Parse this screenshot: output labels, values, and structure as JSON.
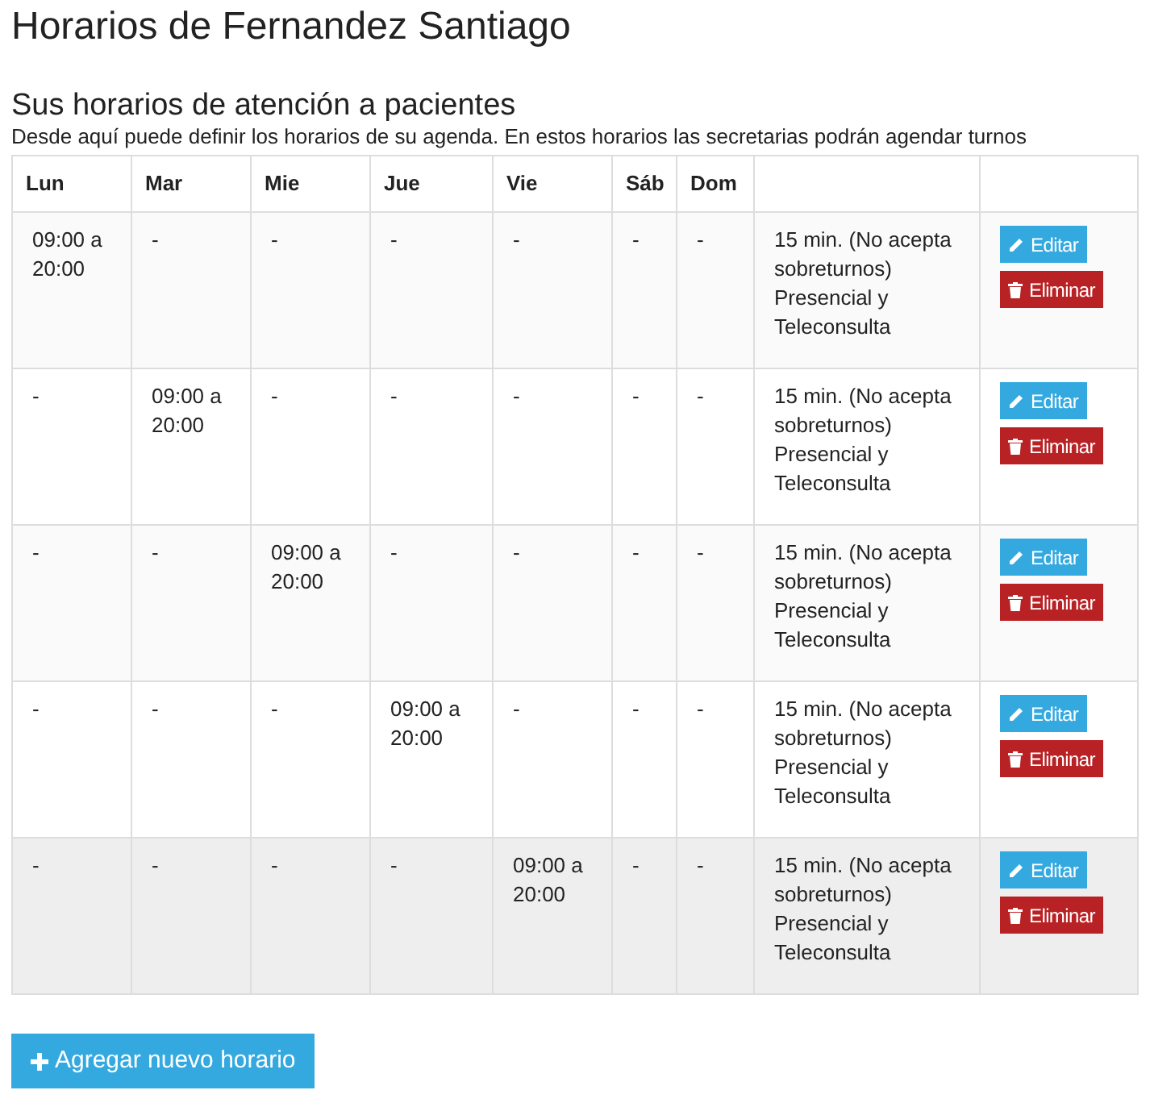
{
  "title": "Horarios de Fernandez Santiago",
  "section": {
    "heading": "Sus horarios de atención a pacientes",
    "description": "Desde aquí puede definir los horarios de su agenda. En estos horarios las secretarias podrán agendar turnos"
  },
  "table": {
    "columns": [
      "Lun",
      "Mar",
      "Mie",
      "Jue",
      "Vie",
      "Sáb",
      "Dom"
    ],
    "rows": [
      {
        "days": [
          "09:00 a 20:00",
          "-",
          "-",
          "-",
          "-",
          "-",
          "-"
        ],
        "detail": "15 min. (No acepta sobreturnos) Presencial y Teleconsulta",
        "edit": "Editar",
        "delete": "Eliminar",
        "hovered": false
      },
      {
        "days": [
          "-",
          "09:00 a 20:00",
          "-",
          "-",
          "-",
          "-",
          "-"
        ],
        "detail": "15 min. (No acepta sobreturnos) Presencial y Teleconsulta",
        "edit": "Editar",
        "delete": "Eliminar",
        "hovered": false
      },
      {
        "days": [
          "-",
          "-",
          "09:00 a 20:00",
          "-",
          "-",
          "-",
          "-"
        ],
        "detail": "15 min. (No acepta sobreturnos) Presencial y Teleconsulta",
        "edit": "Editar",
        "delete": "Eliminar",
        "hovered": false
      },
      {
        "days": [
          "-",
          "-",
          "-",
          "09:00 a 20:00",
          "-",
          "-",
          "-"
        ],
        "detail": "15 min. (No acepta sobreturnos) Presencial y Teleconsulta",
        "edit": "Editar",
        "delete": "Eliminar",
        "hovered": false
      },
      {
        "days": [
          "-",
          "-",
          "-",
          "-",
          "09:00 a 20:00",
          "-",
          "-"
        ],
        "detail": "15 min. (No acepta sobreturnos) Presencial y Teleconsulta",
        "edit": "Editar",
        "delete": "Eliminar",
        "hovered": true
      }
    ]
  },
  "add_button": "Agregar nuevo horario"
}
